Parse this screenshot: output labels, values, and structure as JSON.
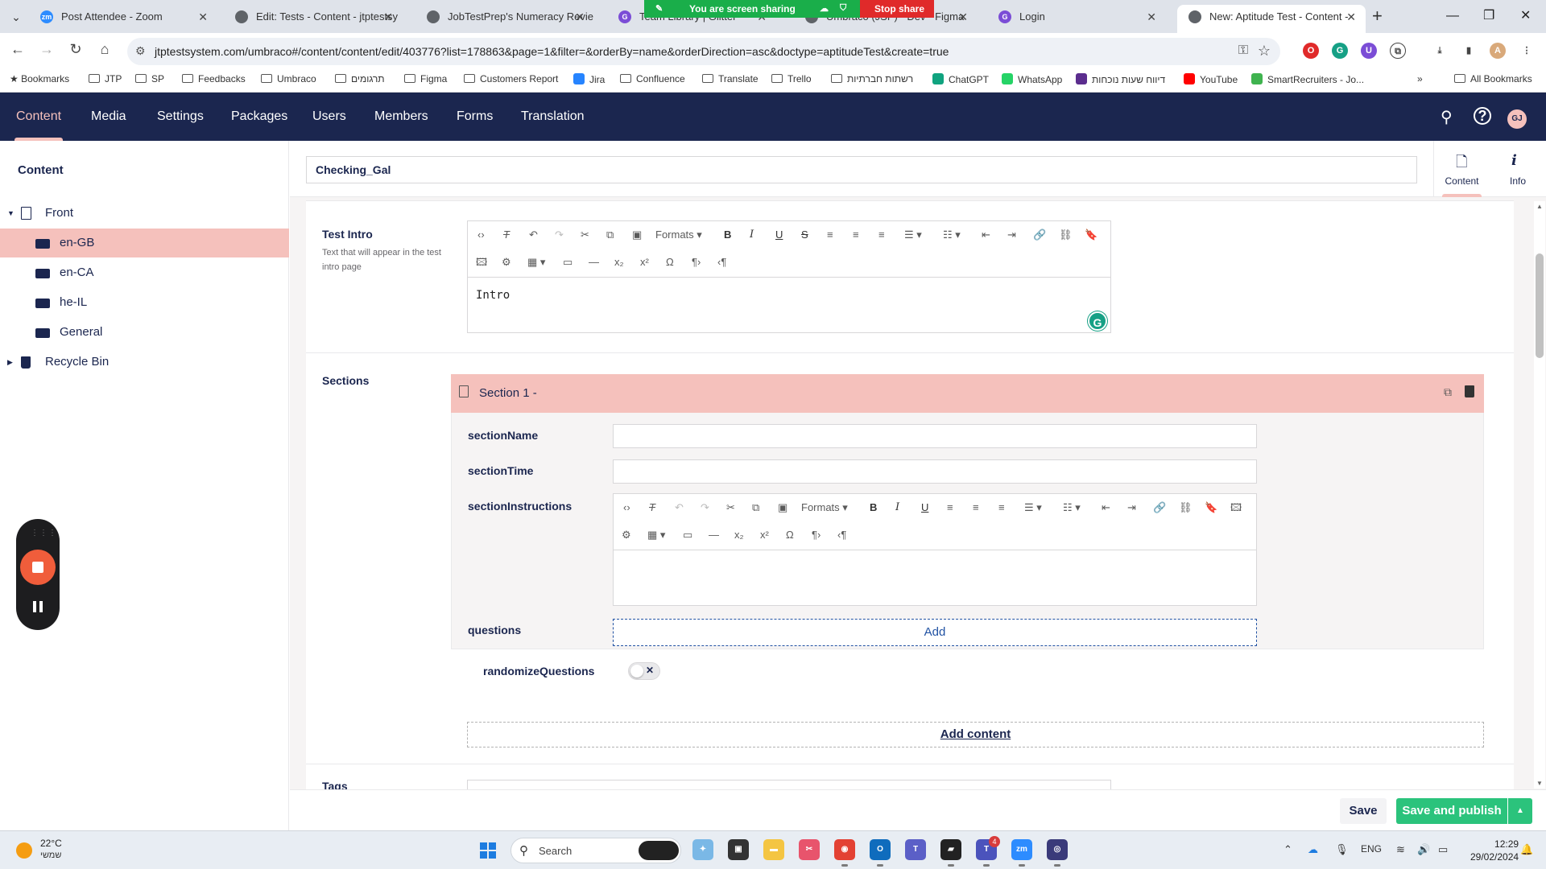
{
  "browser": {
    "tabs": [
      {
        "label": "Post Attendee - Zoom",
        "fav": "zm",
        "color": "#2d8cff"
      },
      {
        "label": "Edit: Tests - Content - jtptestsy",
        "fav": "",
        "color": "#5f6368"
      },
      {
        "label": "JobTestPrep's Numeracy Revie",
        "fav": "",
        "color": "#5f6368"
      },
      {
        "label": "Team Library | Glitter",
        "fav": "G",
        "color": "#7b4dd6"
      },
      {
        "label": "Umbraco (JSP) - Dev - Figma",
        "fav": "",
        "color": "#5f6368"
      },
      {
        "label": "Login",
        "fav": "G",
        "color": "#7b4dd6"
      },
      {
        "label": "New: Aptitude Test - Content -",
        "fav": "",
        "color": "#5f6368"
      }
    ],
    "sharing_label": "You are screen sharing",
    "stop_share_label": "Stop share",
    "url": "jtptestsystem.com/umbraco#/content/content/edit/403776?list=178863&page=1&filter=&orderBy=name&orderDirection=asc&doctype=aptitudeTest&create=true",
    "bookmarks": [
      {
        "label": "Bookmarks",
        "kind": "star"
      },
      {
        "label": "JTP",
        "kind": "folder"
      },
      {
        "label": "SP",
        "kind": "folder"
      },
      {
        "label": "Feedbacks",
        "kind": "folder"
      },
      {
        "label": "Umbraco",
        "kind": "folder"
      },
      {
        "label": "תרגומים",
        "kind": "folder"
      },
      {
        "label": "Figma",
        "kind": "folder"
      },
      {
        "label": "Customers Report",
        "kind": "folder"
      },
      {
        "label": "Jira",
        "kind": "app",
        "color": "#2684ff"
      },
      {
        "label": "Confluence",
        "kind": "folder"
      },
      {
        "label": "Translate",
        "kind": "folder"
      },
      {
        "label": "Trello",
        "kind": "folder"
      },
      {
        "label": "רשתות חברתיות",
        "kind": "folder"
      },
      {
        "label": "ChatGPT",
        "kind": "app",
        "color": "#10a37f"
      },
      {
        "label": "WhatsApp",
        "kind": "app",
        "color": "#25d366"
      },
      {
        "label": "דיווח שעות נוכחות",
        "kind": "app",
        "color": "#5b2d8e"
      },
      {
        "label": "YouTube",
        "kind": "app",
        "color": "#ff0000"
      },
      {
        "label": "SmartRecruiters - Jo...",
        "kind": "app",
        "color": "#3fb34f"
      }
    ],
    "all_bookmarks_label": "All Bookmarks"
  },
  "umbraco": {
    "nav": [
      "Content",
      "Media",
      "Settings",
      "Packages",
      "Users",
      "Members",
      "Forms",
      "Translation"
    ],
    "avatar_initials": "GJ",
    "tree": {
      "title": "Content",
      "items": [
        {
          "label": "Front",
          "kind": "doc",
          "level": 0
        },
        {
          "label": "en-GB",
          "kind": "folder",
          "level": 1
        },
        {
          "label": "en-CA",
          "kind": "folder",
          "level": 1
        },
        {
          "label": "he-IL",
          "kind": "folder",
          "level": 1
        },
        {
          "label": "General",
          "kind": "folder",
          "level": 1
        },
        {
          "label": "Recycle Bin",
          "kind": "bin",
          "level": 0
        }
      ]
    },
    "editor": {
      "node_name": "Checking_Gal",
      "app_tabs": [
        "Content",
        "Info"
      ],
      "test_intro": {
        "label": "Test Intro",
        "description": "Text that will appear in the test intro page",
        "content": "Intro",
        "formats_label": "Formats"
      },
      "sections": {
        "label": "Sections",
        "section_title": "Section 1 -",
        "fields": {
          "section_name": "sectionName",
          "section_time": "sectionTime",
          "section_instructions": "sectionInstructions",
          "questions": "questions",
          "randomize_questions": "randomizeQuestions"
        },
        "formats_label": "Formats",
        "add_label": "Add",
        "randomize_value": false,
        "add_content_label": "Add content"
      },
      "tags_label": "Tags"
    },
    "actions": {
      "save_label": "Save",
      "publish_label": "Save and publish"
    }
  },
  "taskbar": {
    "temperature": "22°C",
    "weather_text": "שמשי",
    "search_label": "Search",
    "language": "ENG",
    "time": "12:29",
    "date": "29/02/2024",
    "teams_badge": "4"
  }
}
